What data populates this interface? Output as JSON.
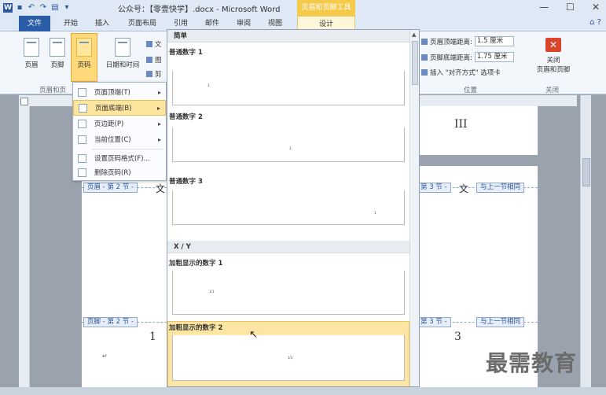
{
  "app": {
    "title": "公众号：【零壹快学】.docx - Microsoft Word",
    "context_tool": "页眉和页脚工具",
    "window_controls": {
      "minimize": "—",
      "maximize": "☐",
      "close": "✕"
    }
  },
  "tabs": [
    "文件",
    "开始",
    "插入",
    "页面布局",
    "引用",
    "邮件",
    "审阅",
    "视图",
    "设计"
  ],
  "ribbon": {
    "header_label": "页眉",
    "footer_label": "页脚",
    "page_number_label": "页码",
    "datetime_label": "日期和时间",
    "text_partial": "文",
    "picture_partial": "图",
    "clip_partial": "剪",
    "group_hf": "页眉和页",
    "header_distance_label": "页眉顶端距离:",
    "header_distance_value": "1.5 厘米",
    "footer_distance_label": "页脚底端距离:",
    "footer_distance_value": "1.75 厘米",
    "insert_align_tab": "插入 \"对齐方式\" 选项卡",
    "group_position": "位置",
    "close_label_1": "关闭",
    "close_label_2": "页眉和页脚",
    "group_close": "关闭"
  },
  "submenu": {
    "items": [
      {
        "label": "页面顶端(T)",
        "has_arrow": true
      },
      {
        "label": "页面底端(B)",
        "has_arrow": true,
        "active": true
      },
      {
        "label": "页边距(P)",
        "has_arrow": true
      },
      {
        "label": "当前位置(C)",
        "has_arrow": true
      },
      {
        "label": "设置页码格式(F)...",
        "has_arrow": false
      },
      {
        "label": "删除页码(R)",
        "has_arrow": false
      }
    ]
  },
  "gallery": {
    "section_simple": "简单",
    "items": [
      {
        "label": "普通数字 1"
      },
      {
        "label": "普通数字 2"
      },
      {
        "label": "普通数字 3"
      }
    ],
    "section_xy": "X / Y",
    "items_xy": [
      {
        "label": "加粗显示的数字 1",
        "sample": "1/1"
      },
      {
        "label": "加粗显示的数字 2",
        "sample": "1/1"
      }
    ]
  },
  "document": {
    "page_top_number": "III",
    "header_tag_left": "页眉 - 第 2 节 -",
    "header_tag_right": "第 3 节 -",
    "same_as_prev": "与上一节相同",
    "footer_tag_left": "页脚 - 第 2 节 -",
    "footer_tag_right": "第 3 节 -",
    "wen": "文",
    "page_num_left": "1",
    "page_num_right": "3",
    "para_mark": "↵"
  },
  "watermark": "最需教育",
  "colors": {
    "accent": "#2b579a",
    "context": "#f5c94a",
    "highlight": "#fde59e"
  }
}
